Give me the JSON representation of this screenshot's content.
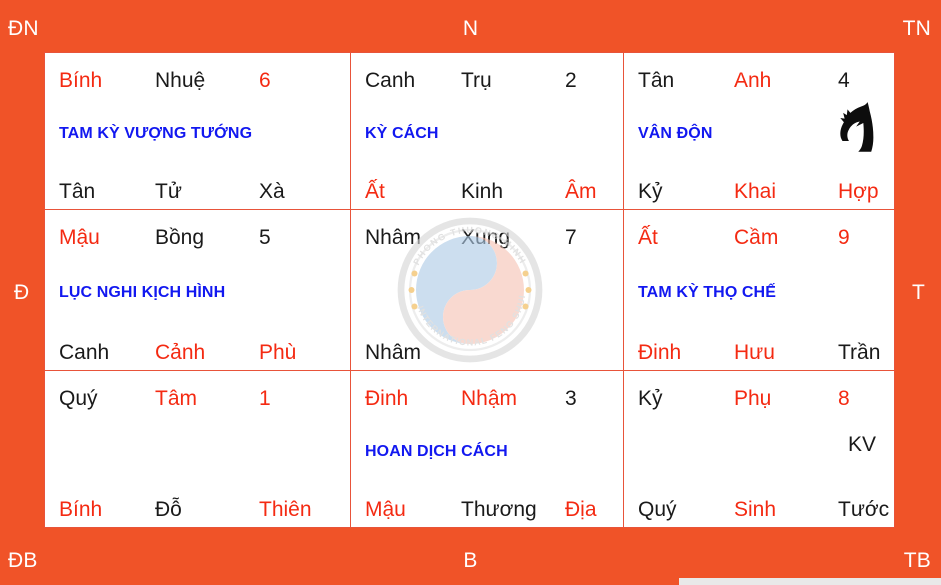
{
  "directions": {
    "top_left": "ĐN",
    "top_center": "N",
    "top_right": "TN",
    "left": "Đ",
    "right": "T",
    "bottom_left": "ĐB",
    "bottom_center": "B",
    "bottom_right": "TB"
  },
  "colors": {
    "background": "#f05328",
    "panel": "#ffffff",
    "grid_line": "#e8543a",
    "red_text": "#f42a12",
    "black_text": "#1a1a1a",
    "blue_text": "#1218f0"
  },
  "watermark": {
    "name": "yin-yang-logo",
    "text_top": "PHONG THUONG MINH",
    "text_bottom": "INTERNATIONAL FENG SHUI"
  },
  "cells": [
    {
      "id": "palace-6",
      "palace_number": "6",
      "top": {
        "stem": "Bính",
        "stem_color": "red",
        "star": "Nhuệ",
        "star_color": "black",
        "number": "6",
        "number_color": "red"
      },
      "pattern": "TAM KỲ VƯỢNG TƯỚNG",
      "bottom": {
        "stem": "Tân",
        "stem_color": "black",
        "door": "Tử",
        "door_color": "black",
        "spirit": "Xà",
        "spirit_color": "black"
      },
      "marker": "",
      "icon": ""
    },
    {
      "id": "palace-2",
      "palace_number": "2",
      "top": {
        "stem": "Canh",
        "stem_color": "black",
        "star": "Trụ",
        "star_color": "black",
        "number": "2",
        "number_color": "black"
      },
      "pattern": "KỲ CÁCH",
      "bottom": {
        "stem": "Ất",
        "stem_color": "red",
        "door": "Kinh",
        "door_color": "black",
        "spirit": "Âm",
        "spirit_color": "red"
      },
      "marker": "",
      "icon": ""
    },
    {
      "id": "palace-4",
      "palace_number": "4",
      "top": {
        "stem": "Tân",
        "stem_color": "black",
        "star": "Anh",
        "star_color": "red",
        "number": "4",
        "number_color": "black"
      },
      "pattern": "VÂN ĐỘN",
      "bottom": {
        "stem": "Kỷ",
        "stem_color": "black",
        "door": "Khai",
        "door_color": "red",
        "spirit": "Hợp",
        "spirit_color": "red"
      },
      "marker": "",
      "icon": "horse-head-icon"
    },
    {
      "id": "palace-5",
      "palace_number": "5",
      "top": {
        "stem": "Mậu",
        "stem_color": "red",
        "star": "Bồng",
        "star_color": "black",
        "number": "5",
        "number_color": "black"
      },
      "pattern": "LỤC NGHI KỊCH HÌNH",
      "bottom": {
        "stem": "Canh",
        "stem_color": "black",
        "door": "Cảnh",
        "door_color": "red",
        "spirit": "Phù",
        "spirit_color": "red"
      },
      "marker": "",
      "icon": ""
    },
    {
      "id": "palace-7",
      "palace_number": "7",
      "top": {
        "stem": "Nhâm",
        "stem_color": "black",
        "star": "Xung",
        "star_color": "black",
        "number": "7",
        "number_color": "black"
      },
      "pattern": "",
      "bottom": {
        "stem": "Nhâm",
        "stem_color": "black",
        "door": "",
        "door_color": "black",
        "spirit": "",
        "spirit_color": "black"
      },
      "marker": "",
      "icon": ""
    },
    {
      "id": "palace-9",
      "palace_number": "9",
      "top": {
        "stem": "Ất",
        "stem_color": "red",
        "star": "Cầm",
        "star_color": "red",
        "number": "9",
        "number_color": "red"
      },
      "pattern": "TAM KỲ THỌ CHẾ",
      "bottom": {
        "stem": "Đinh",
        "stem_color": "red",
        "door": "Hưu",
        "door_color": "red",
        "spirit": "Trần",
        "spirit_color": "black"
      },
      "marker": "",
      "icon": ""
    },
    {
      "id": "palace-1",
      "palace_number": "1",
      "top": {
        "stem": "Quý",
        "stem_color": "black",
        "star": "Tâm",
        "star_color": "red",
        "number": "1",
        "number_color": "red"
      },
      "pattern": "",
      "bottom": {
        "stem": "Bính",
        "stem_color": "red",
        "door": "Đỗ",
        "door_color": "black",
        "spirit": "Thiên",
        "spirit_color": "red"
      },
      "marker": "",
      "icon": ""
    },
    {
      "id": "palace-3",
      "palace_number": "3",
      "top": {
        "stem": "Đinh",
        "stem_color": "red",
        "star": "Nhậm",
        "star_color": "red",
        "number": "3",
        "number_color": "black"
      },
      "pattern": "HOAN DỊCH CÁCH",
      "bottom": {
        "stem": "Mậu",
        "stem_color": "red",
        "door": "Thương",
        "door_color": "black",
        "spirit": "Địa",
        "spirit_color": "red"
      },
      "marker": "",
      "icon": ""
    },
    {
      "id": "palace-8",
      "palace_number": "8",
      "top": {
        "stem": "Kỷ",
        "stem_color": "black",
        "star": "Phụ",
        "star_color": "red",
        "number": "8",
        "number_color": "red"
      },
      "pattern": "",
      "bottom": {
        "stem": "Quý",
        "stem_color": "black",
        "door": "Sinh",
        "door_color": "red",
        "spirit": "Tước",
        "spirit_color": "black"
      },
      "marker": "KV",
      "icon": ""
    }
  ]
}
